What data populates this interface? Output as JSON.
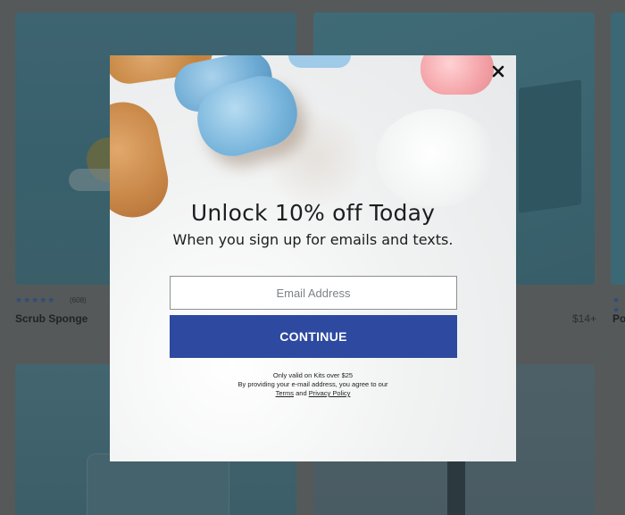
{
  "background_grid": {
    "products": [
      {
        "name": "Scrub Sponge",
        "rating_stars": "★★★★★",
        "review_count": "(608)",
        "price": ""
      },
      {
        "name": "",
        "rating_stars": "",
        "review_count": "",
        "price": "$14+"
      },
      {
        "name": "Po",
        "rating_stars": "★ ★",
        "review_count": "",
        "price": ""
      }
    ]
  },
  "modal": {
    "title": "Unlock 10% off Today",
    "subtitle": "When you sign up for emails and texts.",
    "email_placeholder": "Email Address",
    "email_value": "",
    "continue_label": "CONTINUE",
    "fine_print_line1": "Only valid on Kits over $25",
    "fine_print_line2": "By providing your e-mail address, you agree to our",
    "terms_label": "Terms",
    "and_label": "and",
    "privacy_label": "Privacy Policy",
    "close_icon": "close-icon"
  },
  "colors": {
    "overlay": "#56595a",
    "button": "#2d49a0",
    "modal_bg": "#f6f6f5"
  }
}
